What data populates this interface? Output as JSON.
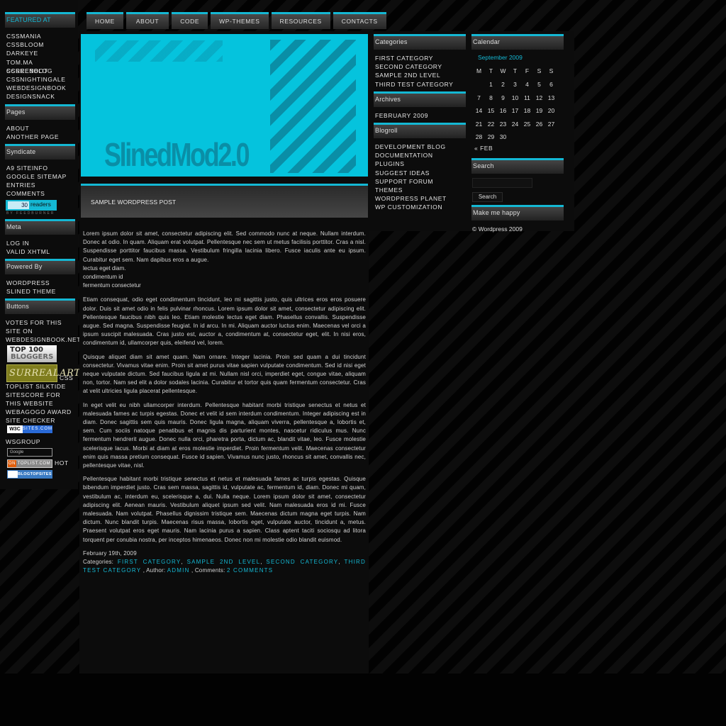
{
  "colors": {
    "accent": "#14b8d4",
    "banner": "#05c3dd",
    "banner_text": "#0a8ea6",
    "panel": "#0c0c0c",
    "background": "#020202"
  },
  "nav": [
    {
      "label": "HOME"
    },
    {
      "label": "ABOUT"
    },
    {
      "label": "CODE"
    },
    {
      "label": "WP-THEMES"
    },
    {
      "label": "RESOURCES"
    },
    {
      "label": "CONTACTS"
    }
  ],
  "banner": {
    "logo": "SlinedMod2.0"
  },
  "left": {
    "featured": {
      "title": "FEATURED AT",
      "items": [
        "CSSMANIA",
        "CSSBLOOM",
        "DARKEYE",
        "TOM.MA SCREENBLOG",
        "CSSREBOOT",
        "CSSNIGHTINGALE",
        "WEBDESIGNBOOK",
        "DESIGNSNACK"
      ]
    },
    "pages": {
      "title": "Pages",
      "items": [
        "ABOUT",
        "ANOTHER PAGE"
      ]
    },
    "syndicate": {
      "title": "Syndicate",
      "items": [
        "A9 SITEINFO",
        "GOOGLE SITEMAP",
        "ENTRIES",
        "COMMENTS"
      ],
      "feed_count": "30",
      "feed_label": "readers",
      "feed_by": "BY FEEDBURNER"
    },
    "meta": {
      "title": "Meta",
      "items": [
        "LOG IN",
        "VALID XHTML"
      ]
    },
    "powered": {
      "title": "Powered By",
      "items": [
        "WORDPRESS",
        "SLINED THEME"
      ]
    },
    "buttons": {
      "title": "Buttons",
      "votes_text": "VOTES FOR THIS SITE ON WEBDESIGNBOOK.NET",
      "top100_line1": "TOP 100",
      "top100_line2": "BLOGGERS",
      "surreal": "SurrealArt",
      "css_label": "CSS",
      "sitescore_text": "TOPLIST SILKTIDE SITESCORE FOR THIS WEBSITE WEBAGOGO AWARD SITE CHECKER",
      "w3c_a": "W3C",
      "w3c_b": "SITES.COM",
      "wsgroup": "WSGROUP",
      "google": "Google",
      "toplist_a": "ON",
      "toplist_b": "TOPLIST.COM",
      "hot": "HOT",
      "blogtop": "BLOGTOPSITES"
    }
  },
  "post": {
    "title": "SAMPLE WORDPRESS POST",
    "para1": "Lorem ipsum dolor sit amet, consectetur adipiscing elit. Sed commodo nunc at neque. Nullam interdum. Donec at odio. In quam. Aliquam erat volutpat. Pellentesque nec sem ut metus facilisis porttitor. Cras a nisl. Suspendisse porttitor faucibus massa. Vestibulum fringilla lacinia libero. Fusce iaculis ante eu ipsum. Curabitur eget sem. Nam dapibus eros a augue.",
    "lines": [
      "lectus eget diam.",
      "condimentum id",
      "fermentum consectetur"
    ],
    "para2": "Etiam consequat, odio eget condimentum tincidunt, leo mi sagittis justo, quis ultrices eros eros posuere dolor. Duis sit amet odio in felis pulvinar rhoncus. Lorem ipsum dolor sit amet, consectetur adipiscing elit. Pellentesque faucibus nibh quis leo. Etiam molestie lectus eget diam. Phasellus convallis. Suspendisse augue. Sed magna. Suspendisse feugiat. In id arcu. In mi. Aliquam auctor luctus enim. Maecenas vel orci a ipsum suscipit malesuada. Cras justo est, auctor a, condimentum at, consectetur eget, elit. In nisi eros, condimentum id, ullamcorper quis, eleifend vel, lorem.",
    "para3": "Quisque aliquet diam sit amet quam. Nam ornare. Integer lacinia. Proin sed quam a dui tincidunt consectetur. Vivamus vitae enim. Proin sit amet purus vitae sapien vulputate condimentum. Sed id nisi eget neque vulputate dictum. Sed faucibus ligula at mi. Nullam nisl orci, imperdiet eget, congue vitae, aliquam non, tortor. Nam sed elit a dolor sodales lacinia. Curabitur et tortor quis quam fermentum consectetur. Cras at velit ultricies ligula placerat pellentesque.",
    "para4": "In eget velit eu nibh ullamcorper interdum. Pellentesque habitant morbi tristique senectus et netus et malesuada fames ac turpis egestas. Donec et velit id sem interdum condimentum. Integer adipiscing est in diam. Donec sagittis sem quis mauris. Donec ligula magna, aliquam viverra, pellentesque a, lobortis et, sem. Cum sociis natoque penatibus et magnis dis parturient montes, nascetur ridiculus mus. Nunc fermentum hendrerit augue. Donec nulla orci, pharetra porta, dictum ac, blandit vitae, leo. Fusce molestie scelerisque lacus. Morbi at diam at eros molestie imperdiet. Proin fermentum velit. Maecenas consectetur enim quis massa pretium consequat. Fusce id sapien. Vivamus nunc justo, rhoncus sit amet, convallis nec, pellentesque vitae, nisl.",
    "para5": "Pellentesque habitant morbi tristique senectus et netus et malesuada fames ac turpis egestas. Quisque bibendum imperdiet justo. Cras sem massa, sagittis id, vulputate ac, fermentum id, diam. Donec mi quam, vestibulum ac, interdum eu, scelerisque a, dui. Nulla neque. Lorem ipsum dolor sit amet, consectetur adipiscing elit. Aenean mauris. Vestibulum aliquet ipsum sed velit. Nam malesuada eros id mi. Fusce malesuada. Nam volutpat. Phasellus dignissim tristique sem. Maecenas dictum magna eget turpis. Nam dictum. Nunc blandit turpis. Maecenas risus massa, lobortis eget, vulputate auctor, tincidunt a, metus. Praesent volutpat eros eget mauris. Nam lacinia purus a sapien. Class aptent taciti sociosqu ad litora torquent per conubia nostra, per inceptos himenaeos. Donec non mi molestie odio blandit euismod.",
    "date": "February 19th, 2009",
    "categories_label": "Categories:",
    "categories": [
      "FIRST CATEGORY",
      "SAMPLE 2ND LEVEL",
      "SECOND CATEGORY",
      "THIRD TEST CATEGORY"
    ],
    "author_label": ", Author:",
    "author": "ADMIN",
    "comments_label": ", Comments:",
    "comments": "2 COMMENTS"
  },
  "right": {
    "categories": {
      "title": "Categories",
      "items": [
        "FIRST CATEGORY",
        "SECOND CATEGORY",
        "SAMPLE 2ND LEVEL",
        "THIRD TEST CATEGORY"
      ]
    },
    "archives": {
      "title": "Archives",
      "items": [
        "FEBRUARY 2009"
      ]
    },
    "blogroll": {
      "title": "Blogroll",
      "items": [
        "DEVELOPMENT BLOG",
        "DOCUMENTATION",
        "PLUGINS",
        "SUGGEST IDEAS",
        "SUPPORT FORUM",
        "THEMES",
        "WORDPRESS PLANET",
        "WP CUSTOMIZATION"
      ]
    },
    "calendar": {
      "title": "Calendar",
      "month": "September 2009",
      "weekdays": [
        "M",
        "T",
        "W",
        "T",
        "F",
        "S",
        "S"
      ],
      "weeks": [
        [
          "",
          "1",
          "2",
          "3",
          "4",
          "5",
          "6"
        ],
        [
          "7",
          "8",
          "9",
          "10",
          "11",
          "12",
          "13"
        ],
        [
          "14",
          "15",
          "16",
          "17",
          "18",
          "19",
          "20"
        ],
        [
          "21",
          "22",
          "23",
          "24",
          "25",
          "26",
          "27"
        ],
        [
          "28",
          "29",
          "30",
          "",
          "",
          "",
          ""
        ]
      ],
      "prev": "« FEB"
    },
    "search": {
      "title": "Search",
      "value": "",
      "button": "Search"
    },
    "happy": {
      "title": "Make me happy",
      "copyright": "© Wordpress 2009"
    }
  }
}
